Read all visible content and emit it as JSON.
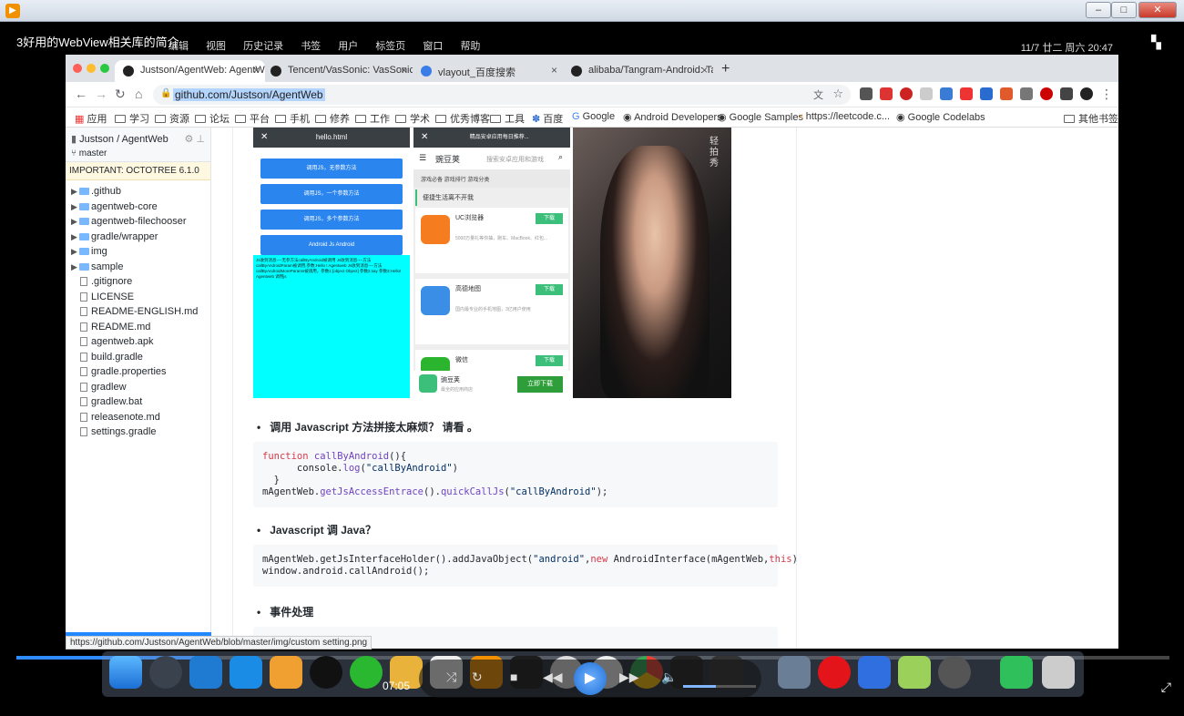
{
  "player": {
    "title": "3好用的WebView相关库的简介",
    "time": "07:05",
    "progress": 0.16,
    "volume": 0.45
  },
  "mac_menu": [
    "编辑",
    "视图",
    "历史记录",
    "书签",
    "用户",
    "标签页",
    "窗口",
    "帮助"
  ],
  "mac_status": "11/7 廿二 周六 20:47",
  "tabs": [
    {
      "label": "Justson/AgentWeb: AgentWe"
    },
    {
      "label": "Tencent/VasSonic: VasSonic is"
    },
    {
      "label": "vlayout_百度搜索"
    },
    {
      "label": "alibaba/Tangram-Android: Tang"
    }
  ],
  "omnibox": {
    "url": "github.com/Justson/AgentWeb"
  },
  "bookmarks": [
    "应用",
    "学习",
    "资源",
    "论坛",
    "平台",
    "手机",
    "修养",
    "工作",
    "学术",
    "优秀博客",
    "工具",
    "百度",
    "Google",
    "Android Developers",
    "Google Samples",
    "https://leetcode.c...",
    "Google Codelabs",
    "其他书签"
  ],
  "sidebar": {
    "repo": "Justson / AgentWeb",
    "branch": "master",
    "notice": "IMPORTANT: OCTOTREE 6.1.0",
    "items": [
      {
        "label": ".github",
        "type": "folder"
      },
      {
        "label": "agentweb-core",
        "type": "folder"
      },
      {
        "label": "agentweb-filechooser",
        "type": "folder"
      },
      {
        "label": "gradle/wrapper",
        "type": "folder"
      },
      {
        "label": "img",
        "type": "folder"
      },
      {
        "label": "sample",
        "type": "folder"
      },
      {
        "label": ".gitignore",
        "type": "file"
      },
      {
        "label": "LICENSE",
        "type": "file"
      },
      {
        "label": "README-ENGLISH.md",
        "type": "file"
      },
      {
        "label": "README.md",
        "type": "file"
      },
      {
        "label": "agentweb.apk",
        "type": "file"
      },
      {
        "label": "build.gradle",
        "type": "file"
      },
      {
        "label": "gradle.properties",
        "type": "file"
      },
      {
        "label": "gradlew",
        "type": "file"
      },
      {
        "label": "gradlew.bat",
        "type": "file"
      },
      {
        "label": "releasenote.md",
        "type": "file"
      },
      {
        "label": "settings.gradle",
        "type": "file"
      }
    ]
  },
  "shot1": {
    "header": "hello.html",
    "buttons": [
      "调用JS，无参数方法",
      "调用JS，一个参数方法",
      "调用JS，多个参数方法",
      "Android Js Android"
    ],
    "log": "Js收到消息----无参方法callByAndroid被调用  Js收到消息----方法callByAndroidParam被调用,参数:Hello ! Agentweb  Js收到消息----方法callByAndroidMoreParams被调用，参数1:[object Object] 参数2:say 参数3:Hello! Agentweb  调用js"
  },
  "shot2": {
    "header": "精品安卓应用每日推荐...",
    "logo": "豌豆荚",
    "search_placeholder": "搜索安卓应用和游戏",
    "cats": "游戏必备   游戏排行   游戏分类",
    "section": "便捷生活离不开我",
    "apps": [
      {
        "name": "UC浏览器",
        "desc": "5000万量礼等你抽，跑车、MacBook、红包...",
        "btn": "下载",
        "color": "#f57c1f"
      },
      {
        "name": "高德地图",
        "desc": "国内最专业的手机地图，3亿用户使用",
        "btn": "下载",
        "color": "#3a8ee6"
      },
      {
        "name": "微信",
        "desc": "",
        "btn": "下载",
        "color": "#2bb52e"
      }
    ],
    "footer_name": "豌豆荚",
    "footer_sub": "最全的应用商店",
    "install": "立即下载"
  },
  "shot3": {
    "watermark": "轻拍秀"
  },
  "readme": {
    "bullet1": "调用 Javascript 方法拼接太麻烦？ 请看 。",
    "bullet2": "Javascript 调 Java？",
    "bullet3": "事件处理"
  },
  "status_url": "https://github.com/Justson/AgentWeb/blob/master/img/custom setting.png"
}
